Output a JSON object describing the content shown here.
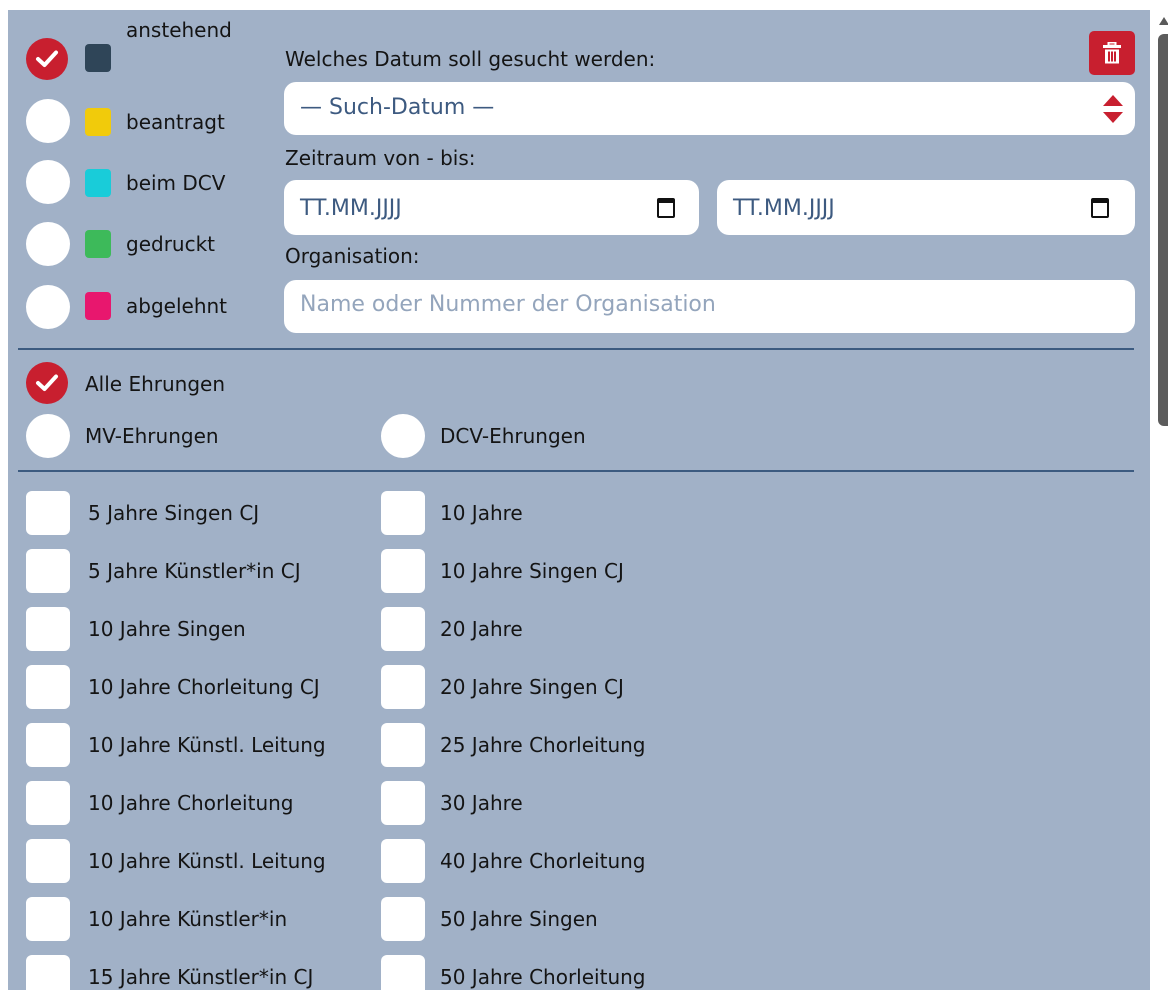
{
  "status_filters": [
    {
      "label": "anstehend",
      "checked": true,
      "color": "#2f4558"
    },
    {
      "label": "beantragt",
      "checked": false,
      "color": "#f1cb0b"
    },
    {
      "label": "beim DCV",
      "checked": false,
      "color": "#19ccd9"
    },
    {
      "label": "gedruckt",
      "checked": false,
      "color": "#3dba5a"
    },
    {
      "label": "abgelehnt",
      "checked": false,
      "color": "#e8176e"
    }
  ],
  "search": {
    "date_label": "Welches Datum soll gesucht werden:",
    "date_select_value": "— Such-Datum —",
    "period_label": "Zeitraum von - bis:",
    "date_from_placeholder": "TT.MM.JJJJ",
    "date_to_placeholder": "TT.MM.JJJJ",
    "org_label": "Organisation:",
    "org_placeholder": "Name oder Nummer der Organisation"
  },
  "honor_types": [
    {
      "label": "Alle Ehrungen",
      "checked": true
    },
    {
      "label": "MV-Ehrungen",
      "checked": false
    },
    {
      "label": "DCV-Ehrungen",
      "checked": false
    }
  ],
  "honors_left": [
    "5 Jahre Singen CJ",
    "5 Jahre Künstler*in CJ",
    "10 Jahre Singen",
    "10 Jahre Chorleitung CJ",
    "10 Jahre Künstl. Leitung",
    "10 Jahre Chorleitung",
    "10 Jahre Künstl. Leitung",
    "10 Jahre Künstler*in",
    "15 Jahre Künstler*in CJ"
  ],
  "honors_right": [
    "10 Jahre",
    "10 Jahre Singen CJ",
    "20 Jahre",
    "20 Jahre Singen CJ",
    "25 Jahre Chorleitung",
    "30 Jahre",
    "40 Jahre Chorleitung",
    "50 Jahre Singen",
    "50 Jahre Chorleitung"
  ],
  "icons": {
    "delete": "trash-icon",
    "calendar": "calendar-icon",
    "select": "sort-arrows-icon"
  },
  "colors": {
    "panel_bg": "#a1b1c7",
    "accent_red": "#c81f2f",
    "divider": "#3c5b80"
  }
}
